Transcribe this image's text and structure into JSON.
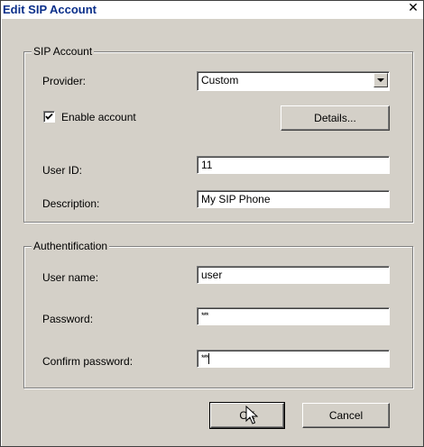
{
  "window": {
    "title": "Edit SIP Account",
    "close_glyph": "✕"
  },
  "sip_group": {
    "legend": "SIP Account",
    "provider_label": "Provider:",
    "provider_value": "Custom",
    "enable_label": "Enable account",
    "enable_checked": true,
    "details_button": "Details...",
    "userid_label": "User ID:",
    "userid_value": "11",
    "description_label": "Description:",
    "description_value": "My SIP Phone"
  },
  "auth_group": {
    "legend": "Authentification",
    "username_label": "User name:",
    "username_value": "user",
    "password_label": "Password:",
    "password_value": "***",
    "confirm_label": "Confirm password:",
    "confirm_value": "***"
  },
  "buttons": {
    "ok": "OK",
    "cancel": "Cancel"
  },
  "icons": {
    "close": "close-icon",
    "check": "check-icon",
    "combo": "chevron-down-icon",
    "cursor": "mouse-pointer-icon"
  }
}
